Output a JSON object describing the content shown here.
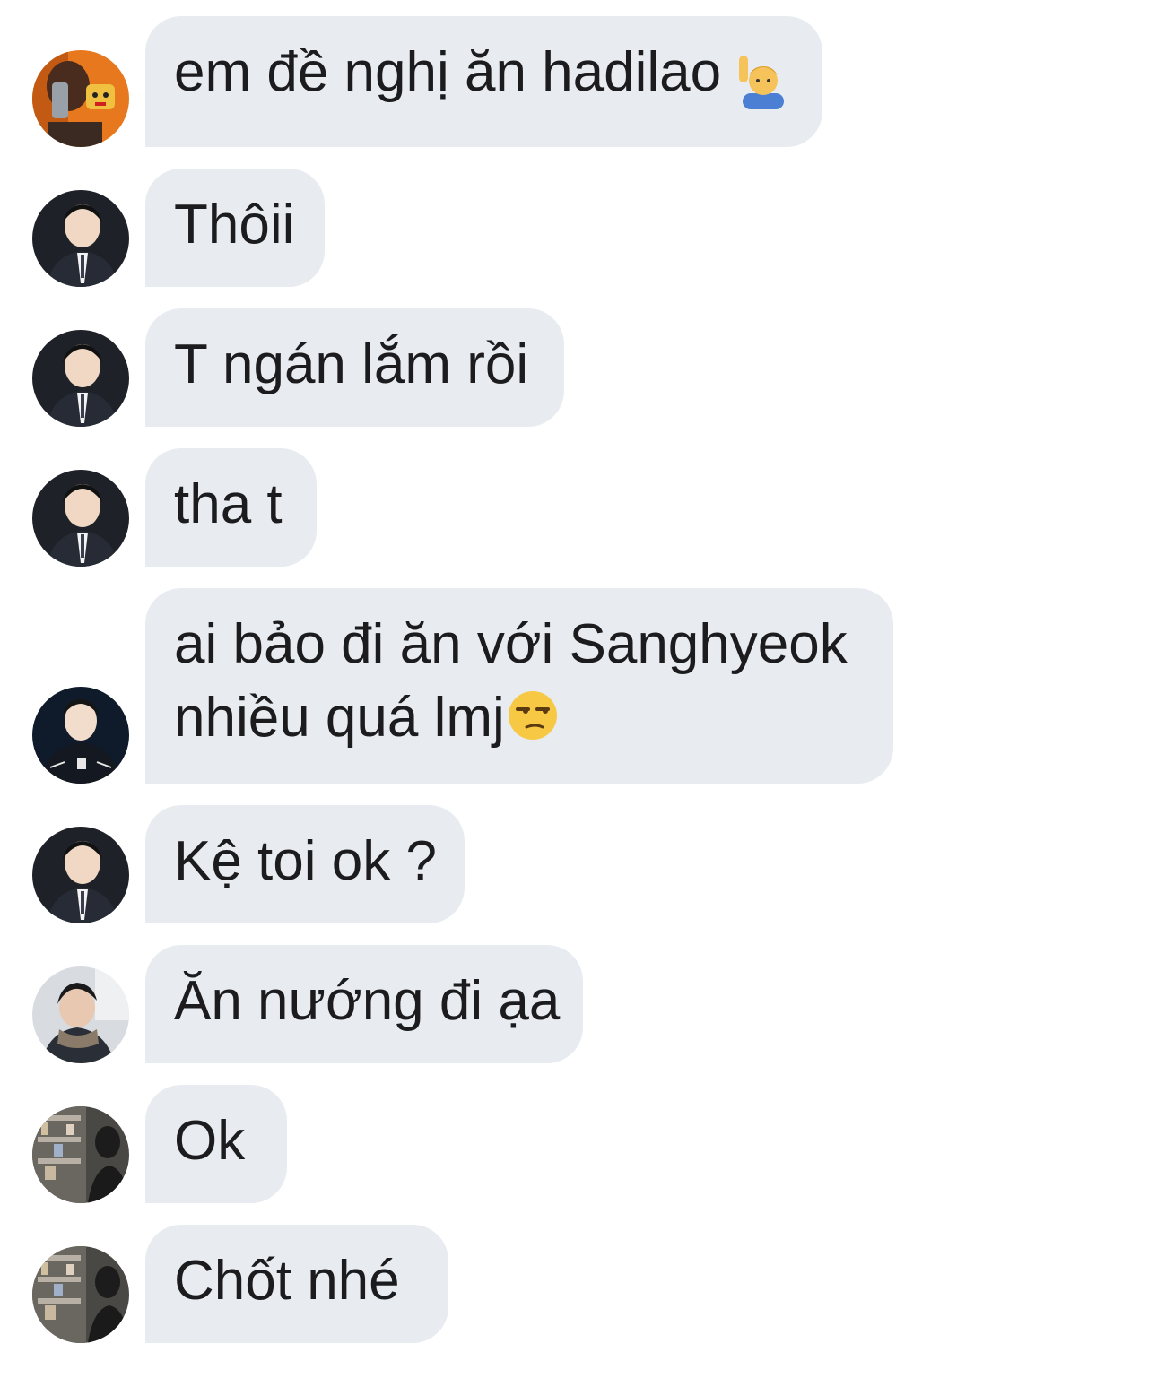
{
  "messages": [
    {
      "avatar": "avatar-orange",
      "lines": [
        "em đề nghị ăn hadilao"
      ],
      "emoji": "man-raising-hand-emoji"
    },
    {
      "avatar": "avatar-suit",
      "lines": [
        "Thôii"
      ]
    },
    {
      "avatar": "avatar-suit",
      "lines": [
        "T ngán lắm rồi"
      ]
    },
    {
      "avatar": "avatar-suit",
      "lines": [
        "tha t"
      ]
    },
    {
      "avatar": "avatar-dark-jacket",
      "lines": [
        "ai bảo đi ăn với Sanghyeok",
        "nhiều quá lmj"
      ],
      "emoji": "unamused-face-emoji"
    },
    {
      "avatar": "avatar-suit",
      "lines": [
        "Kệ toi ok ?"
      ]
    },
    {
      "avatar": "avatar-scarf",
      "lines": [
        "Ăn nướng đi ạa"
      ]
    },
    {
      "avatar": "avatar-shelves",
      "lines": [
        "Ok"
      ]
    },
    {
      "avatar": "avatar-shelves",
      "lines": [
        "Chốt nhé"
      ]
    }
  ],
  "colors": {
    "bubble": "#e8ecf0",
    "text": "#1c1c1e",
    "background": "#ffffff"
  }
}
